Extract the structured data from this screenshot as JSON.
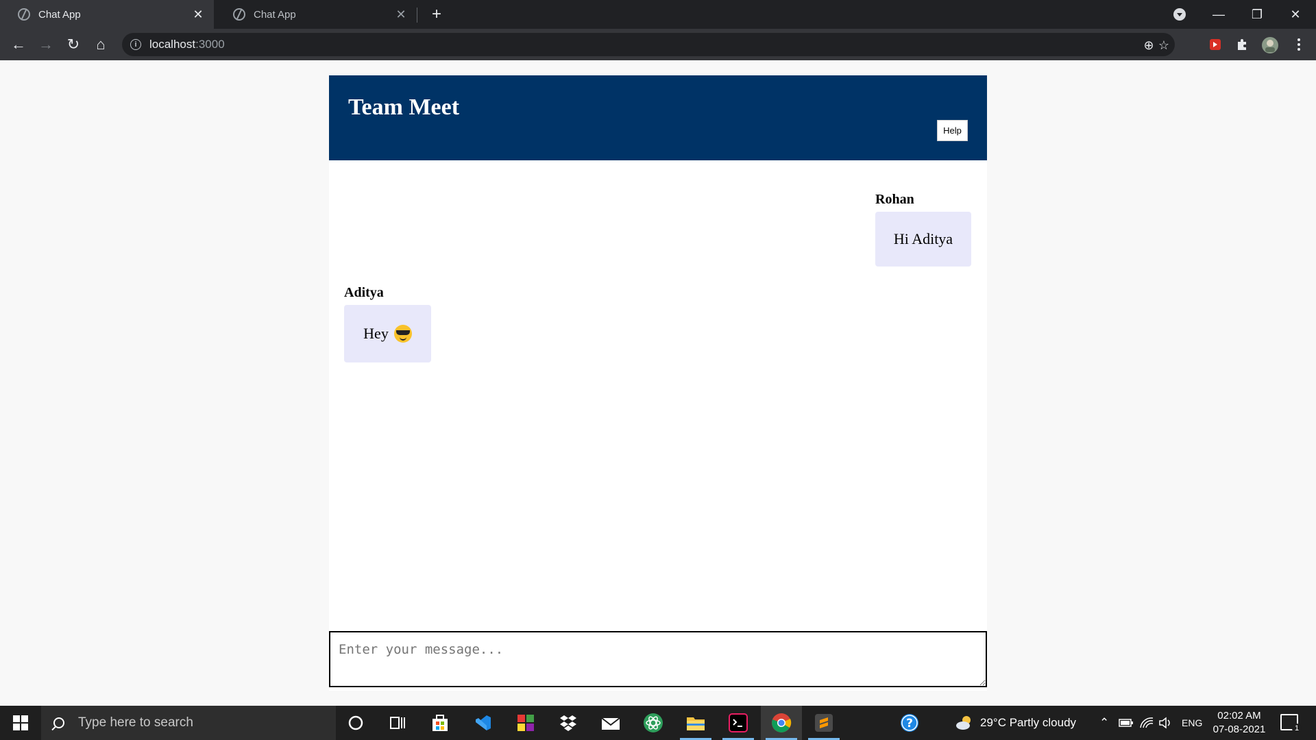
{
  "browser": {
    "tabs": [
      {
        "title": "Chat App",
        "active": true
      },
      {
        "title": "Chat App",
        "active": false
      }
    ],
    "url_host": "localhost",
    "url_port": ":3000"
  },
  "app": {
    "title": "Team Meet",
    "help_label": "Help",
    "messages": [
      {
        "sender": "Rohan",
        "text": "Hi Aditya",
        "align": "right"
      },
      {
        "sender": "Aditya",
        "text": "Hey",
        "emoji": "smiling-face-with-sunglasses",
        "align": "left"
      }
    ],
    "input_placeholder": "Enter your message..."
  },
  "taskbar": {
    "search_placeholder": "Type here to search",
    "weather": "29°C  Partly cloudy",
    "language": "ENG",
    "time": "02:02 AM",
    "date": "07-08-2021",
    "notification_count": "1"
  },
  "colors": {
    "header_bg": "#003366",
    "bubble_bg": "#e8e8fa"
  }
}
